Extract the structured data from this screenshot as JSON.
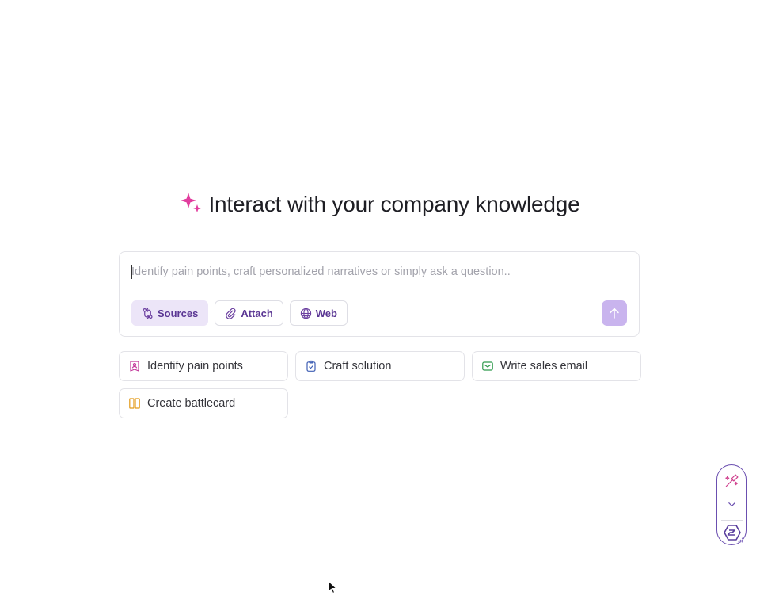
{
  "hero": {
    "title": "Interact with your company knowledge",
    "icon": "sparkle-icon",
    "accent": "#e23d9e"
  },
  "composer": {
    "placeholder": "Identify pain points, craft personalized narratives or simply ask a question..",
    "value": "",
    "tools": [
      {
        "label": "Sources",
        "icon": "git-compare-icon",
        "active": true
      },
      {
        "label": "Attach",
        "icon": "paperclip-icon",
        "active": false
      },
      {
        "label": "Web",
        "icon": "globe-icon",
        "active": false
      }
    ],
    "send_icon": "arrow-up-icon",
    "send_color": "#c9b4ee"
  },
  "suggestions": [
    {
      "label": "Identify pain points",
      "icon": "badge-icon",
      "color": "#c2389a"
    },
    {
      "label": "Craft solution",
      "icon": "clipboard-check-icon",
      "color": "#3f5fb4"
    },
    {
      "label": "Write sales email",
      "icon": "mail-icon",
      "color": "#2f9a4c"
    },
    {
      "label": "Create battlecard",
      "icon": "columns-icon",
      "color": "#e39a18"
    }
  ],
  "widget": {
    "icons": [
      "magic-wand-icon",
      "chevron-down-icon",
      "brand-logo-icon",
      "resize-grip-icon"
    ],
    "border_color": "#6b4fb0"
  },
  "colors": {
    "tool_text": "#5b3794",
    "active_tool_bg": "#ece5f8"
  }
}
